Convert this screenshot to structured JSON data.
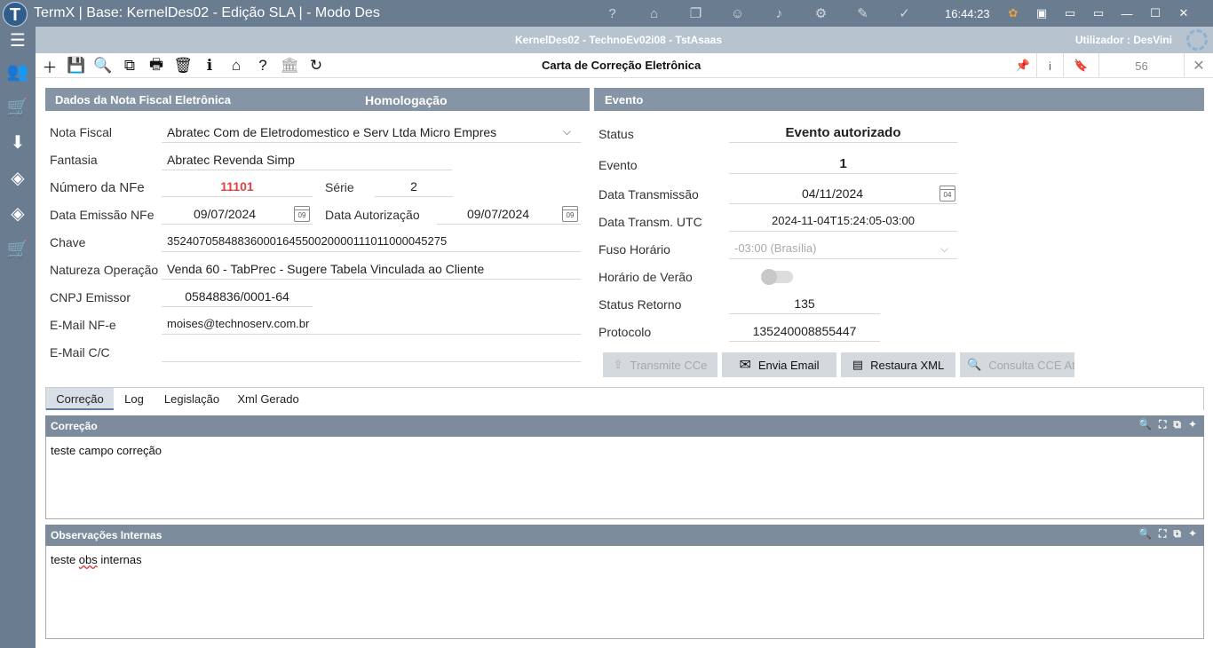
{
  "window": {
    "app_logo": "T",
    "title": "TermX | Base: KernelDes02 - Edição SLA | - Modo Des",
    "clock": "16:44:23",
    "titlebar_icons": [
      "help-icon",
      "bank-icon",
      "windows-icon",
      "user-icon",
      "bell-icon",
      "gear-icon",
      "chat-icon",
      "check-icon"
    ],
    "win_buttons": [
      "—",
      "☐",
      "✕"
    ]
  },
  "sidebar": {
    "items": [
      "menu-icon",
      "users-icon",
      "cart-icon",
      "basket-icon",
      "brazil-map-icon",
      "brazil-map-icon",
      "cart-filter-icon"
    ]
  },
  "subheader": {
    "center": "KernelDes02 - TechnoEv02i08 - TstAsaas",
    "user_label": "Utilizador :",
    "user_name": "DesVini"
  },
  "toolbar": {
    "tools": [
      "plus-icon",
      "save-icon",
      "search-icon",
      "copy-icon",
      "print-icon",
      "delete-icon",
      "info-icon",
      "bank-home-icon",
      "help-icon",
      "institution-icon",
      "refresh-icon"
    ],
    "form_title": "Carta de Correção Eletrônica",
    "right_info": "i",
    "record_count": "56",
    "close": "✕"
  },
  "nfe_panel": {
    "title": "Dados da Nota Fiscal Eletrônica",
    "env": "Homologação",
    "nota_fiscal_label": "Nota Fiscal",
    "nota_fiscal_value": "Abratec Com de Eletrodomestico e Serv Ltda Micro Empres",
    "fantasia_label": "Fantasia",
    "fantasia_value": "Abratec Revenda Simp",
    "numero_label": "Número da NFe",
    "numero_value": "11101",
    "serie_label": "Série",
    "serie_value": "2",
    "data_emissao_label": "Data Emissão NFe",
    "data_emissao_value": "09/07/2024",
    "data_autorizacao_label": "Data Autorização",
    "data_autorizacao_value": "09/07/2024",
    "chave_label": "Chave",
    "chave_value": "35240705848836000164550020000111011000045275",
    "natureza_label": "Natureza Operação",
    "natureza_value": "Venda 60 - TabPrec - Sugere Tabela Vinculada ao Cliente",
    "cnpj_label": "CNPJ Emissor",
    "cnpj_value": "05848836/0001-64",
    "email_label": "E-Mail NF-e",
    "email_value": "moises@technoserv.com.br",
    "email_cc_label": "E-Mail C/C",
    "email_cc_value": "",
    "cal_day": "09"
  },
  "evento_panel": {
    "title": "Evento",
    "status_label": "Status",
    "status_value": "Evento autorizado",
    "evento_label": "Evento",
    "evento_value": "1",
    "data_trans_label": "Data Transmissão",
    "data_trans_value": "04/11/2024",
    "data_utc_label": "Data Transm. UTC",
    "data_utc_value": "2024-11-04T15:24:05-03:00",
    "fuso_label": "Fuso Horário",
    "fuso_value": "-03:00 (Brasília)",
    "verao_label": "Horário de Verão",
    "verao_on": false,
    "status_ret_label": "Status Retorno",
    "status_ret_value": "135",
    "protocolo_label": "Protocolo",
    "protocolo_value": "135240008855447",
    "cal_day": "04",
    "buttons": {
      "transmite": "Transmite CCe",
      "envia": "Envia Email",
      "restaura": "Restaura XML",
      "consulta": "Consulta CCE Atua"
    }
  },
  "tabs": [
    "Correção",
    "Log",
    "Legislação",
    "Xml Gerado"
  ],
  "correcao": {
    "title": "Correção",
    "text": "teste campo correção"
  },
  "observacoes": {
    "title": "Observações Internas",
    "text_before": "teste ",
    "text_misspelled": "obs",
    "text_after": " internas"
  },
  "colors": {
    "titlebar": "#697c90",
    "panel_header": "#8595a5",
    "accent_red": "#e04040"
  }
}
